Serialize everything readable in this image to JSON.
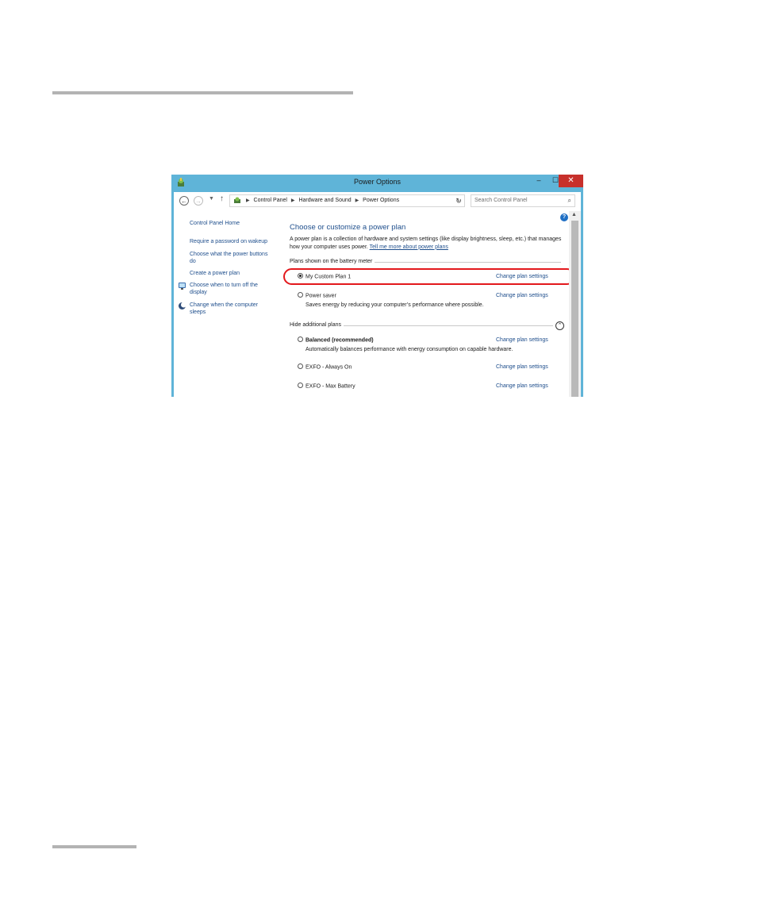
{
  "window": {
    "title": "Power Options",
    "controls": {
      "minimize": "–",
      "maximize": "☐",
      "close": "✕"
    }
  },
  "address_bar": {
    "breadcrumbs": [
      "Control Panel",
      "Hardware and Sound",
      "Power Options"
    ],
    "search_placeholder": "Search Control Panel"
  },
  "sidebar": {
    "home": "Control Panel Home",
    "items": [
      "Require a password on wakeup",
      "Choose what the power buttons do",
      "Create a power plan",
      "Choose when to turn off the display",
      "Change when the computer sleeps"
    ]
  },
  "main": {
    "heading": "Choose or customize a power plan",
    "description": "A power plan is a collection of hardware and system settings (like display brightness, sleep, etc.) that manages how your computer uses power.",
    "description_link": "Tell me more about power plans",
    "group_battery": "Plans shown on the battery meter",
    "group_hidden": "Hide additional plans",
    "change_label": "Change plan settings",
    "plans": [
      {
        "name": "My Custom Plan 1",
        "selected": true,
        "desc": ""
      },
      {
        "name": "Power saver",
        "selected": false,
        "desc": "Saves energy by reducing your computer’s performance where possible."
      },
      {
        "name": "Balanced (recommended)",
        "selected": false,
        "desc": "Automatically balances performance with energy consumption on capable hardware."
      },
      {
        "name": "EXFO - Always On",
        "selected": false,
        "desc": ""
      },
      {
        "name": "EXFO - Max Battery",
        "selected": false,
        "desc": ""
      }
    ]
  },
  "colors": {
    "window_frame": "#5fb4d8",
    "close_button": "#c7302b",
    "link": "#1e4e8c",
    "highlight": "#e3181c"
  }
}
